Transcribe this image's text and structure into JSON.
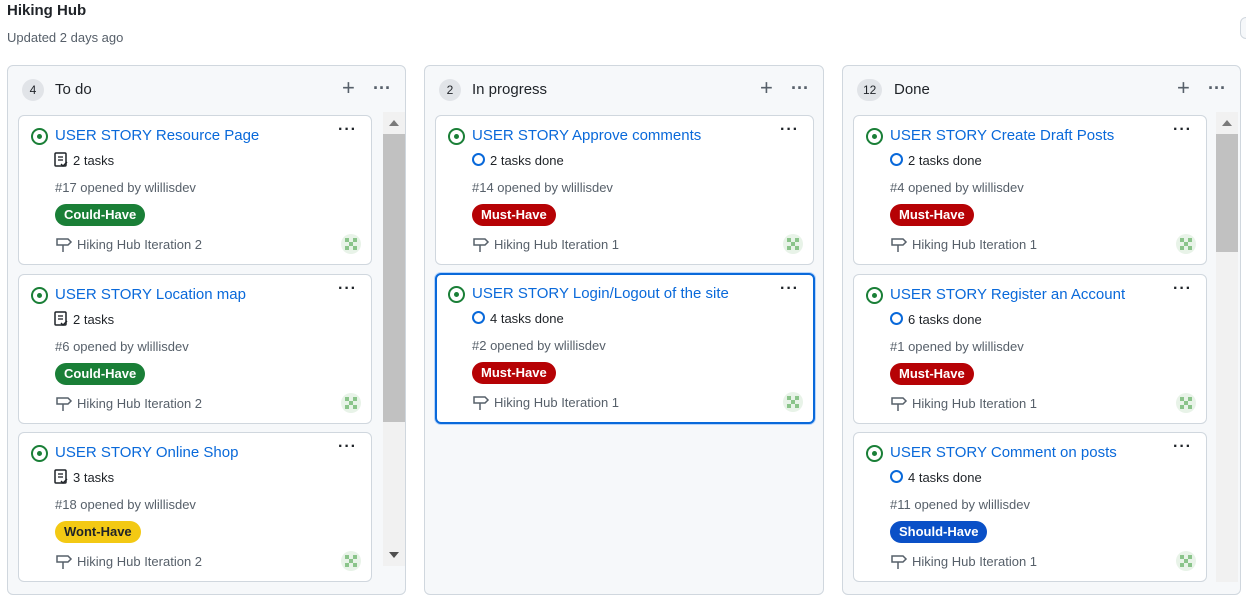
{
  "page": {
    "title": "Hiking Hub",
    "updated": "Updated 2 days ago"
  },
  "columns": [
    {
      "count": "4",
      "title": "To do",
      "cards": [
        {
          "title": "USER STORY Resource Page",
          "tasks": "2 tasks",
          "task_kind": "list",
          "meta": "#17 opened by wlillisdev",
          "label": "Could-Have",
          "label_color": "#1a7f37",
          "label_text_color": "#ffffff",
          "milestone": "Hiking Hub Iteration 2"
        },
        {
          "title": "USER STORY Location map",
          "tasks": "2 tasks",
          "task_kind": "list",
          "meta": "#6 opened by wlillisdev",
          "label": "Could-Have",
          "label_color": "#1a7f37",
          "label_text_color": "#ffffff",
          "milestone": "Hiking Hub Iteration 2"
        },
        {
          "title": "USER STORY Online Shop",
          "tasks": "3 tasks",
          "task_kind": "list",
          "meta": "#18 opened by wlillisdev",
          "label": "Wont-Have",
          "label_color": "#f3c914",
          "label_text_color": "#1f2328",
          "milestone": "Hiking Hub Iteration 2"
        }
      ]
    },
    {
      "count": "2",
      "title": "In progress",
      "cards": [
        {
          "title": "USER STORY Approve comments",
          "tasks": "2 tasks done",
          "task_kind": "ring",
          "meta": "#14 opened by wlillisdev",
          "label": "Must-Have",
          "label_color": "#b60205",
          "label_text_color": "#ffffff",
          "milestone": "Hiking Hub Iteration 1"
        },
        {
          "title": "USER STORY Login/Logout of the site",
          "tasks": "4 tasks done",
          "task_kind": "ring",
          "meta": "#2 opened by wlillisdev",
          "label": "Must-Have",
          "label_color": "#b60205",
          "label_text_color": "#ffffff",
          "milestone": "Hiking Hub Iteration 1"
        }
      ]
    },
    {
      "count": "12",
      "title": "Done",
      "cards": [
        {
          "title": "USER STORY Create Draft Posts",
          "tasks": "2 tasks done",
          "task_kind": "ring",
          "meta": "#4 opened by wlillisdev",
          "label": "Must-Have",
          "label_color": "#b60205",
          "label_text_color": "#ffffff",
          "milestone": "Hiking Hub Iteration 1"
        },
        {
          "title": "USER STORY Register an Account",
          "tasks": "6 tasks done",
          "task_kind": "ring",
          "meta": "#1 opened by wlillisdev",
          "label": "Must-Have",
          "label_color": "#b60205",
          "label_text_color": "#ffffff",
          "milestone": "Hiking Hub Iteration 1"
        },
        {
          "title": "USER STORY Comment on posts",
          "tasks": "4 tasks done",
          "task_kind": "ring",
          "meta": "#11 opened by wlillisdev",
          "label": "Should-Have",
          "label_color": "#0a50c7",
          "label_text_color": "#ffffff",
          "milestone": "Hiking Hub Iteration 1"
        }
      ]
    }
  ],
  "icons": {
    "status": "issue-opened-icon",
    "tasks_list": "tasklist-icon",
    "tasks_ring": "progress-ring-icon",
    "milestone": "milestone-icon",
    "avatar": "avatar-icon",
    "add": "plus-icon",
    "menu": "kebab-menu-icon"
  }
}
